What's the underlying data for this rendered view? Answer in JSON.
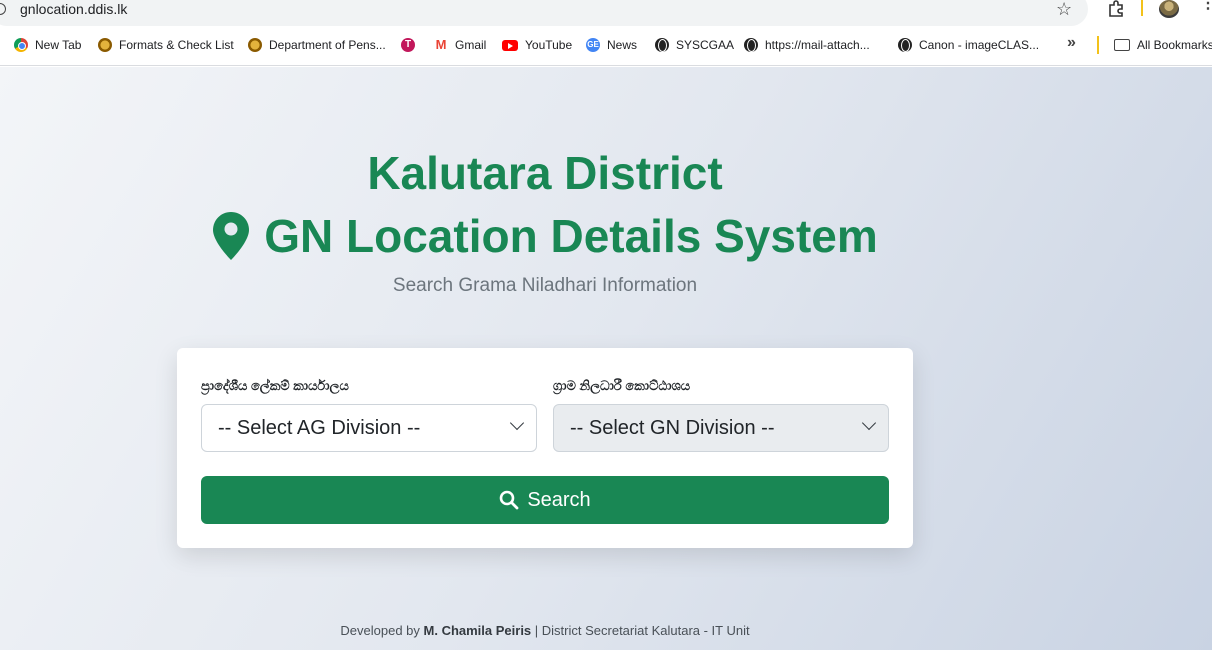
{
  "browser": {
    "url": "gnlocation.ddis.lk",
    "bookmarks": [
      {
        "label": "New Tab",
        "icon": "chrome-icon"
      },
      {
        "label": "Formats & Check List",
        "icon": "emblem-icon"
      },
      {
        "label": "Department of Pens...",
        "icon": "emblem-icon"
      },
      {
        "label": "",
        "icon": "t-icon"
      },
      {
        "label": "Gmail",
        "icon": "gmail-icon"
      },
      {
        "label": "YouTube",
        "icon": "youtube-icon"
      },
      {
        "label": "News",
        "icon": "news-icon"
      },
      {
        "label": "SYSCGAA",
        "icon": "globe-icon"
      },
      {
        "label": "https://mail-attach...",
        "icon": "globe-icon"
      },
      {
        "label": "Canon - imageCLAS...",
        "icon": "globe-icon"
      }
    ],
    "all_bookmarks": "All Bookmarks"
  },
  "header": {
    "title_line1": "Kalutara District",
    "title_line2": "GN Location Details System",
    "subtitle": "Search Grama Niladhari Information"
  },
  "form": {
    "ag_label": "ප්‍රාදේශීය ලේකම් කාර්යාලය",
    "ag_placeholder": "-- Select AG Division --",
    "gn_label": "ග්‍රාම නිලධාරී කොට්ඨාශය",
    "gn_placeholder": "-- Select GN Division --",
    "search_label": "Search"
  },
  "footer": {
    "prefix": "Developed by",
    "author": "M. Chamila Peiris",
    "suffix": "| District Secretariat Kalutara - IT Unit"
  },
  "colors": {
    "primary": "#198754",
    "muted": "#6c757d"
  }
}
